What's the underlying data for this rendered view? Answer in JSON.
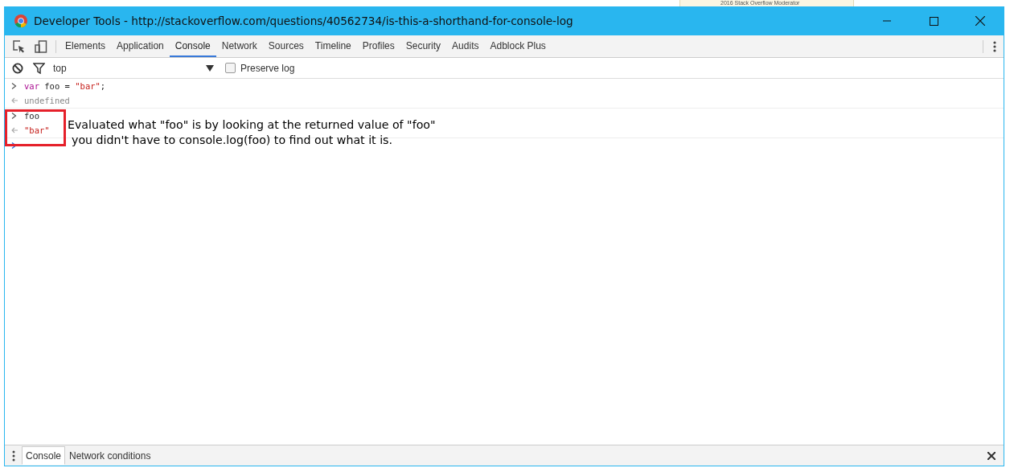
{
  "background_page": {
    "card_text": "2016 Stack Overflow Moderator"
  },
  "window": {
    "title": "Developer Tools - http://stackoverflow.com/questions/40562734/is-this-a-shorthand-for-console-log"
  },
  "tabs": [
    {
      "label": "Elements",
      "selected": false
    },
    {
      "label": "Application",
      "selected": false
    },
    {
      "label": "Console",
      "selected": true
    },
    {
      "label": "Network",
      "selected": false
    },
    {
      "label": "Sources",
      "selected": false
    },
    {
      "label": "Timeline",
      "selected": false
    },
    {
      "label": "Profiles",
      "selected": false
    },
    {
      "label": "Security",
      "selected": false
    },
    {
      "label": "Audits",
      "selected": false
    },
    {
      "label": "Adblock Plus",
      "selected": false
    }
  ],
  "filter_bar": {
    "context": "top",
    "preserve_log": {
      "label": "Preserve log",
      "checked": false
    }
  },
  "console": [
    {
      "kind": "input",
      "tokens": [
        {
          "kind": "keyword",
          "text": "var"
        },
        {
          "kind": "plain",
          "text": " foo = "
        },
        {
          "kind": "string",
          "text": "\"bar\""
        },
        {
          "kind": "plain",
          "text": ";"
        }
      ]
    },
    {
      "kind": "result",
      "tokens": [
        {
          "kind": "undefined",
          "text": "undefined"
        }
      ]
    },
    {
      "kind": "input",
      "tokens": [
        {
          "kind": "plain",
          "text": "foo"
        }
      ]
    },
    {
      "kind": "result",
      "tokens": [
        {
          "kind": "string",
          "text": "\"bar\""
        }
      ]
    },
    {
      "kind": "prompt"
    }
  ],
  "annotation": {
    "lines": [
      "Evaluated what \"foo\" is  by looking at the returned value of \"foo\"",
      "you didn't have to console.log(foo) to find out what it is."
    ]
  },
  "drawer_tabs": [
    {
      "label": "Console",
      "selected": true
    },
    {
      "label": "Network conditions",
      "selected": false
    }
  ]
}
